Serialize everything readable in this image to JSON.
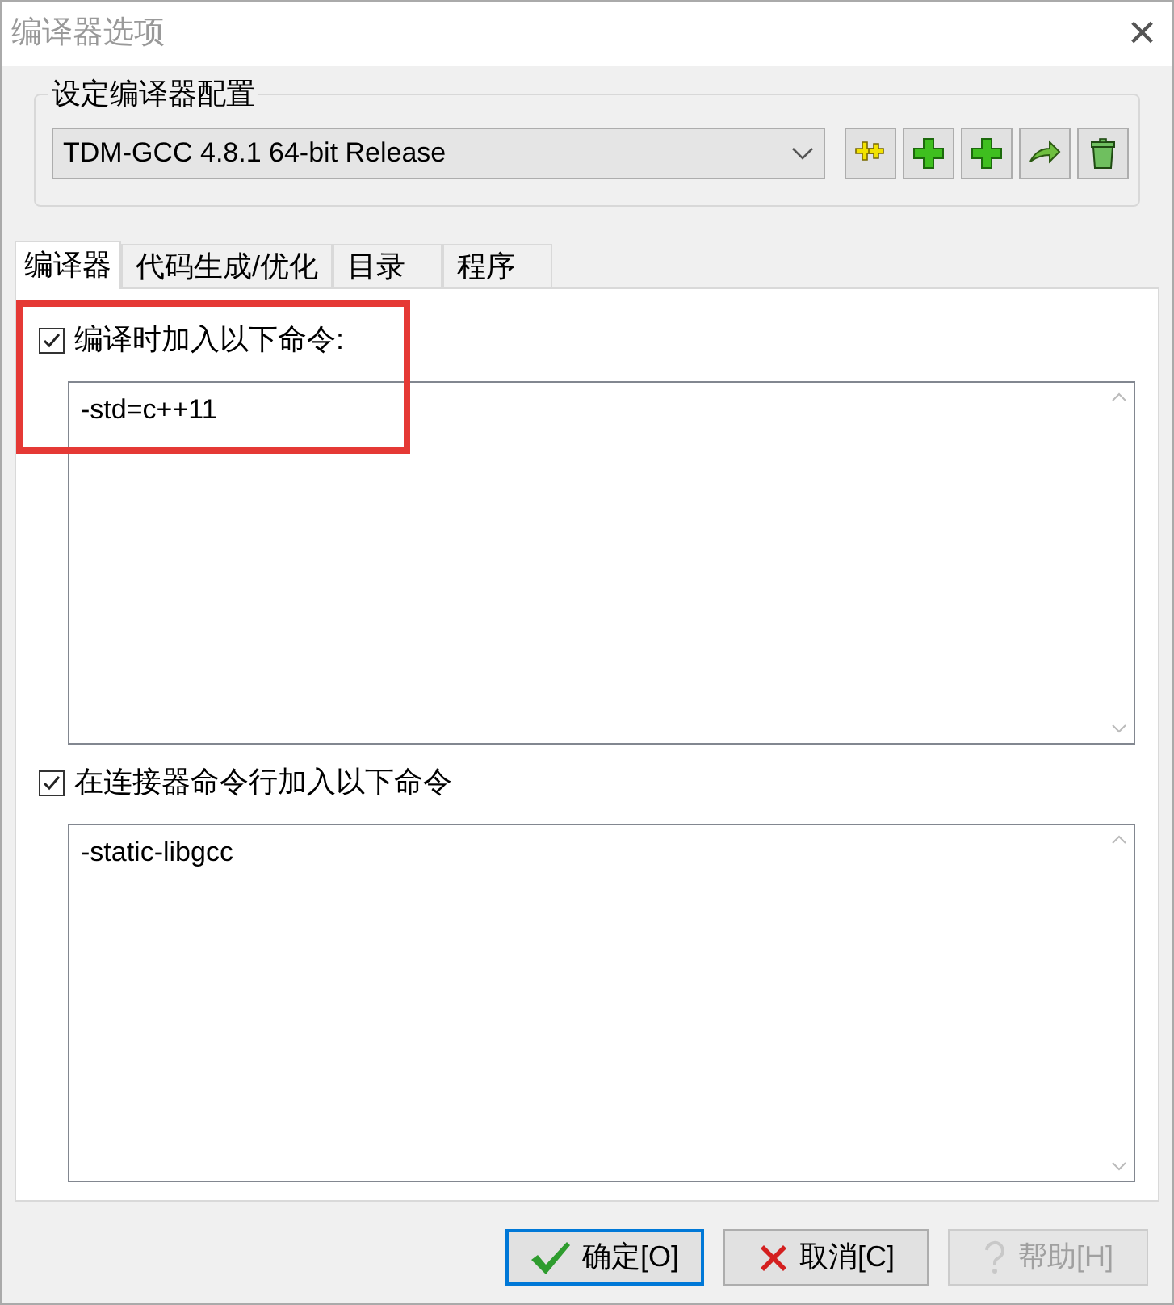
{
  "window": {
    "title": "编译器选项",
    "close": "×"
  },
  "compiler_set": {
    "label": "设定编译器配置",
    "value": "TDM-GCC 4.8.1 64-bit Release"
  },
  "toolbar": [
    {
      "kind": "copy"
    },
    {
      "kind": "add"
    },
    {
      "kind": "add"
    },
    {
      "kind": "rename"
    },
    {
      "kind": "delete"
    }
  ],
  "tabs": [
    {
      "label": "编译器",
      "selected": true
    },
    {
      "label": "代码生成/优化",
      "selected": false
    },
    {
      "label": "目录",
      "selected": false
    },
    {
      "label": "程序",
      "selected": false
    }
  ],
  "options": [
    {
      "label": "编译时加入以下命令:",
      "checked": true,
      "value": "-std=c++11",
      "highlighted": true
    },
    {
      "label": "在连接器命令行加入以下命令",
      "checked": true,
      "value": "-static-libgcc",
      "highlighted": false
    }
  ],
  "buttons": [
    {
      "kind": "ok",
      "label": "确定[O]",
      "disabled": false,
      "default": true
    },
    {
      "kind": "cancel",
      "label": "取消[C]",
      "disabled": false,
      "default": false
    },
    {
      "kind": "help",
      "label": "帮助[H]",
      "disabled": true,
      "default": false
    }
  ]
}
